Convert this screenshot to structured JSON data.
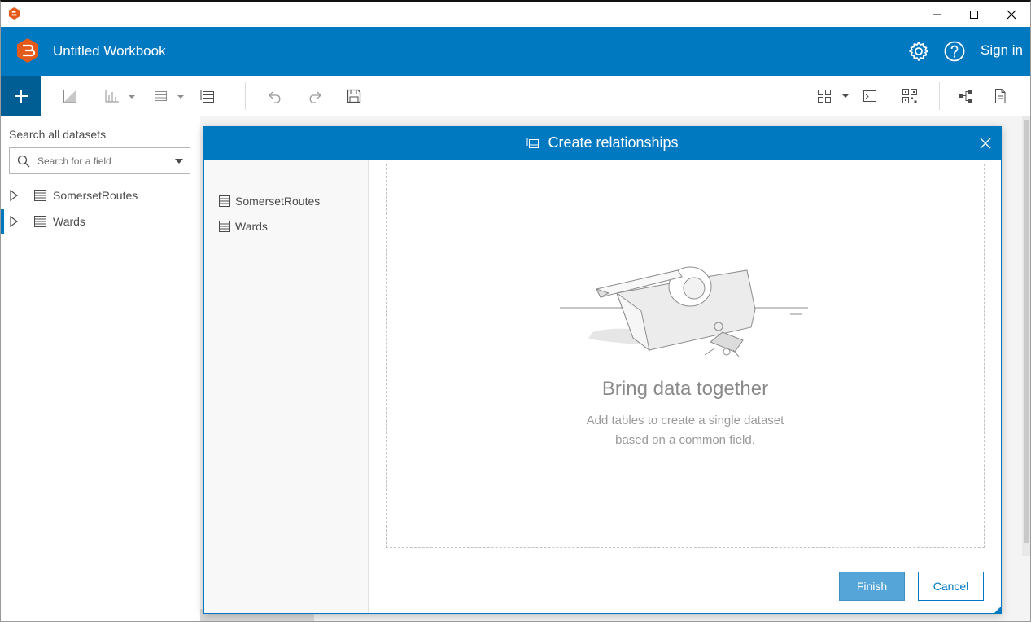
{
  "window": {
    "minimize_icon": "minimize-icon",
    "maximize_icon": "maximize-icon",
    "close_icon": "close-icon"
  },
  "header": {
    "title": "Untitled Workbook",
    "sign_in": "Sign in",
    "brand_color": "#0079c1",
    "logo_color": "#e35a1a"
  },
  "toolbar": {
    "items": [
      "add-icon",
      "text-card-icon",
      "chart-icon",
      "table-icon",
      "dataset-icon",
      "undo-icon",
      "redo-icon",
      "save-icon",
      "layout-icon",
      "console-icon",
      "qr-icon",
      "model-icon",
      "page-icon"
    ]
  },
  "left_panel": {
    "search_label": "Search all datasets",
    "search_placeholder": "Search for a field",
    "datasets": [
      {
        "label": "SomersetRoutes"
      },
      {
        "label": "Wards"
      }
    ]
  },
  "dialog": {
    "title": "Create relationships",
    "tables": [
      {
        "label": "SomersetRoutes"
      },
      {
        "label": "Wards"
      }
    ],
    "empty_title": "Bring data together",
    "empty_line1": "Add tables to create a single dataset",
    "empty_line2": "based on a common field.",
    "finish_label": "Finish",
    "cancel_label": "Cancel"
  }
}
